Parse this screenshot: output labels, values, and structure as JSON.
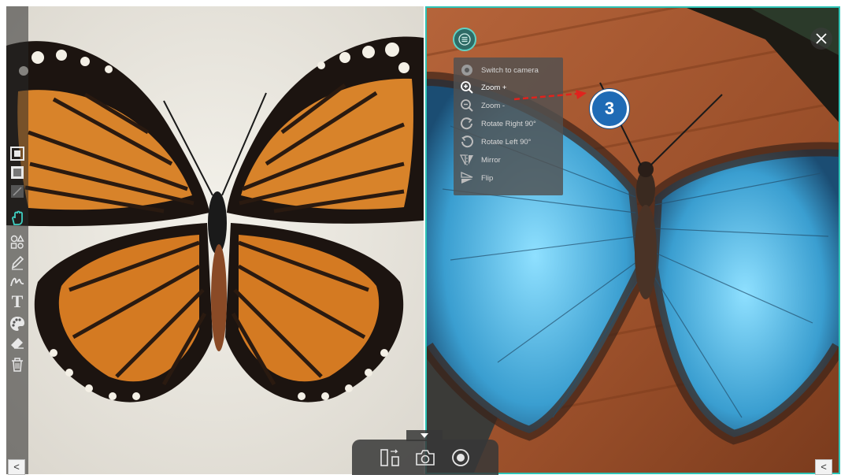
{
  "left_toolbar": {
    "tools": [
      {
        "name": "select-frame-icon"
      },
      {
        "name": "spotlight-frame-icon"
      },
      {
        "name": "crop-icon"
      },
      {
        "name": "hand-pan-icon",
        "active": true
      },
      {
        "name": "shapes-icon"
      },
      {
        "name": "pencil-icon"
      },
      {
        "name": "freehand-icon"
      },
      {
        "name": "text-icon",
        "glyph": "T"
      },
      {
        "name": "palette-icon"
      },
      {
        "name": "eraser-icon"
      },
      {
        "name": "trash-icon"
      }
    ],
    "collapse_label": "<",
    "active_color": "#3fd0c2"
  },
  "context_menu": {
    "items": [
      {
        "label": "Switch to camera",
        "icon": "camera-circle-icon"
      },
      {
        "label": "Zoom +",
        "icon": "zoom-in-icon",
        "active": true
      },
      {
        "label": "Zoom -",
        "icon": "zoom-out-icon"
      },
      {
        "label": "Rotate Right 90°",
        "icon": "rotate-right-icon"
      },
      {
        "label": "Rotate Left 90°",
        "icon": "rotate-left-icon"
      },
      {
        "label": "Mirror",
        "icon": "mirror-icon"
      },
      {
        "label": "Flip",
        "icon": "flip-icon"
      }
    ]
  },
  "callout": {
    "number": "3",
    "color": "#1f6bb5"
  },
  "right_pane": {
    "border_color": "#2ec4b6",
    "collapse_label": "<"
  },
  "bottom_toolbar": {
    "tab_icon": "caret-down-icon",
    "buttons": [
      {
        "name": "swap-layout-icon"
      },
      {
        "name": "camera-icon"
      },
      {
        "name": "record-icon"
      }
    ]
  }
}
